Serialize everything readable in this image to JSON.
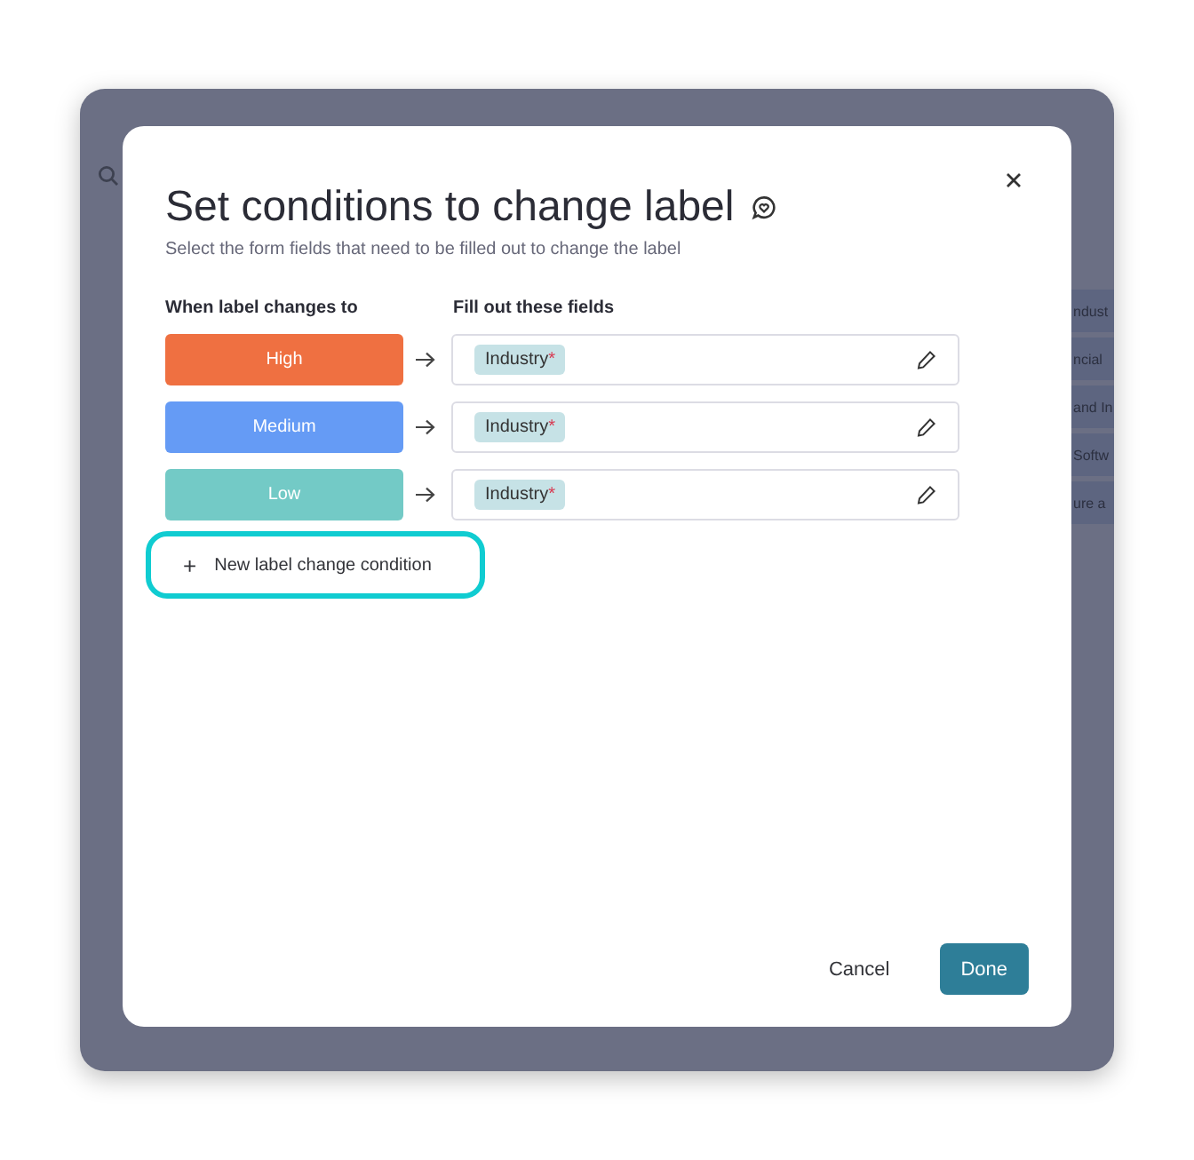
{
  "background": {
    "rows": [
      "ndust",
      "ncial",
      "and In",
      "Softw",
      "ure a"
    ]
  },
  "dialog": {
    "title": "Set conditions to change label",
    "subtitle": "Select the form fields that need to be filled out to change the label",
    "columns": [
      "When label changes to",
      "Fill out these fields"
    ],
    "conditions": [
      {
        "label": "High",
        "color": "#ef7041",
        "fields": [
          {
            "name": "Industry",
            "required_mark": "*"
          }
        ]
      },
      {
        "label": "Medium",
        "color": "#659bf5",
        "fields": [
          {
            "name": "Industry",
            "required_mark": "*"
          }
        ]
      },
      {
        "label": "Low",
        "color": "#73cac6",
        "fields": [
          {
            "name": "Industry",
            "required_mark": "*"
          }
        ]
      }
    ],
    "add_button": {
      "icon": "+",
      "label": "New label change condition",
      "highlighted": true
    },
    "buttons": [
      {
        "label": "Cancel",
        "kind": "secondary"
      },
      {
        "label": "Done",
        "kind": "primary"
      }
    ]
  }
}
